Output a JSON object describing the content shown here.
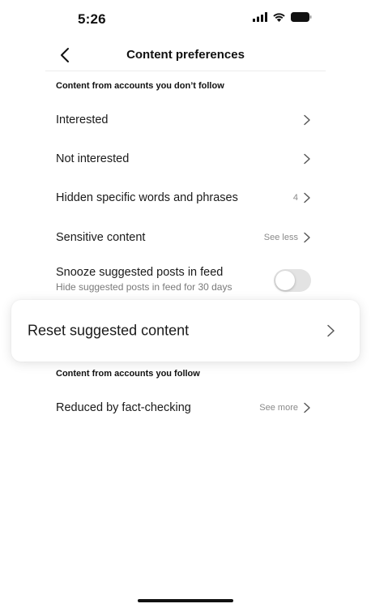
{
  "status_bar": {
    "time": "5:26"
  },
  "nav": {
    "title": "Content preferences"
  },
  "section_unfollowed": {
    "header": "Content from accounts you don’t follow",
    "rows": [
      {
        "label": "Interested",
        "value": ""
      },
      {
        "label": "Not interested",
        "value": ""
      },
      {
        "label": "Hidden specific words and phrases",
        "value": "4"
      },
      {
        "label": "Sensitive content",
        "value": "See less"
      }
    ],
    "snooze": {
      "title": "Snooze suggested posts in feed",
      "subtitle": "Hide suggested posts in feed for 30 days",
      "enabled": false
    }
  },
  "reset": {
    "label": "Reset suggested content"
  },
  "section_followed": {
    "header": "Content from accounts you follow",
    "rows": [
      {
        "label": "Reduced by fact-checking",
        "value": "See more"
      }
    ]
  },
  "colors": {
    "toggle_off": "#e3e3e3",
    "text_primary": "#1a1a1a",
    "text_secondary": "#8a8a8a"
  }
}
